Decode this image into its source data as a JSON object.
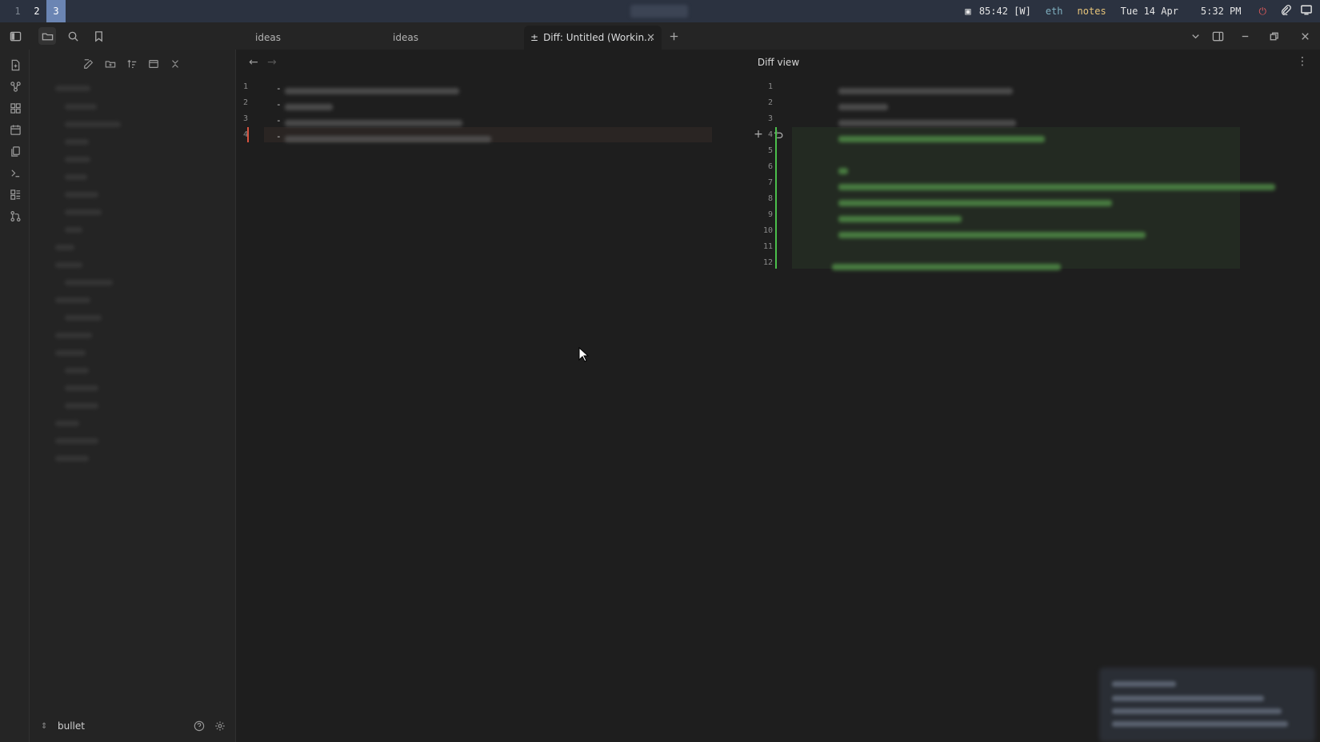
{
  "sysbar": {
    "workspaces": [
      {
        "label": "1",
        "state": "inactive"
      },
      {
        "label": "2",
        "state": "active"
      },
      {
        "label": "3",
        "state": "focused"
      }
    ],
    "battery": "85:42 [W]",
    "network": "eth",
    "notes": "notes",
    "date": "Tue 14 Apr",
    "time": "5:32 PM"
  },
  "tabs": [
    {
      "label": "ideas"
    },
    {
      "label": "ideas"
    },
    {
      "label": "Diff: Untitled (Workin...",
      "icon": "diff-icon",
      "active": true
    }
  ],
  "view": {
    "title": "Diff view"
  },
  "left_lines": [
    "1",
    "2",
    "3",
    "4"
  ],
  "right_lines": [
    "1",
    "2",
    "3",
    "4",
    "5",
    "6",
    "7",
    "8",
    "9",
    "10",
    "11",
    "12"
  ],
  "explorer": {
    "vault_name": "bullet"
  },
  "colors": {
    "removed": "#d9533f",
    "added": "#4bbf4b",
    "accent": "#6b85b3"
  }
}
